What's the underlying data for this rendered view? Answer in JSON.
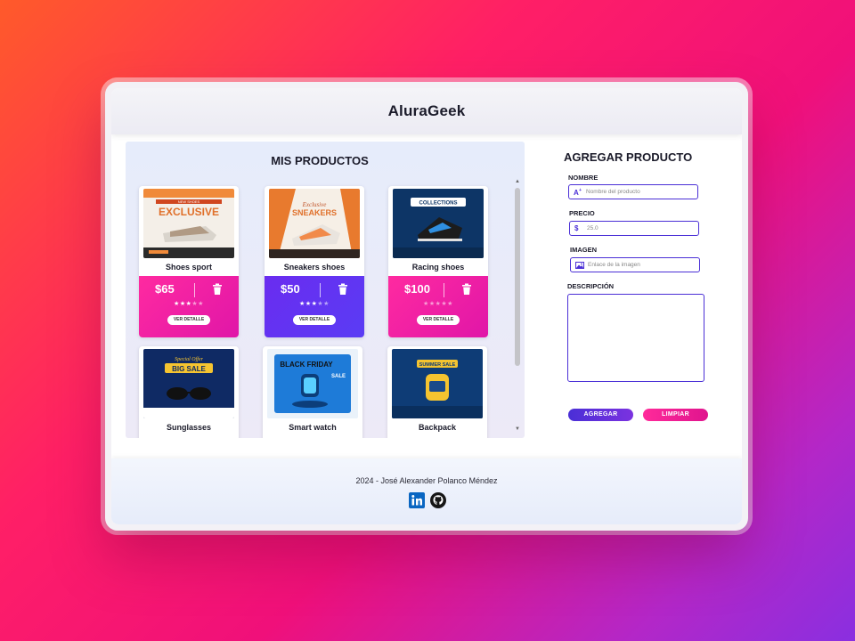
{
  "header": {
    "brand": "AluraGeek"
  },
  "products": {
    "title": "MIS PRODUCTOS",
    "items": [
      {
        "name": "Shoes sport",
        "price": "$65",
        "rating": 3,
        "detail_label": "VER DETALLE",
        "theme": "pink",
        "image": "shoes-sport-ad-image"
      },
      {
        "name": "Sneakers shoes",
        "price": "$50",
        "rating": 3,
        "detail_label": "VER DETALLE",
        "theme": "purple",
        "image": "sneakers-ad-image"
      },
      {
        "name": "Racing shoes",
        "price": "$100",
        "rating": 0,
        "detail_label": "VER DETALLE",
        "theme": "pink",
        "image": "racing-shoes-ad-image"
      },
      {
        "name": "Sunglasses",
        "image": "sunglasses-ad-image"
      },
      {
        "name": "Smart watch",
        "image": "smart-watch-ad-image"
      },
      {
        "name": "Backpack",
        "image": "backpack-ad-image"
      }
    ],
    "image_text": {
      "exclusive": "EXCLUSIVE",
      "new_shoes": "NEW SHOES",
      "sneakers": "SNEAKERS",
      "collections": "COLLECTIONS",
      "big_sale": "BIG SALE",
      "special_offer": "Special Offer",
      "black_friday": "BLACK FRIDAY",
      "sale": "SALE",
      "summer_sale": "SUMMER SALE"
    }
  },
  "form": {
    "title": "AGREGAR PRODUCTO",
    "name": {
      "label": "NOMBRE",
      "placeholder": "Nombre del producto",
      "icon": "text-add-icon"
    },
    "price": {
      "label": "PRECIO",
      "placeholder": "25.0",
      "icon": "dollar-icon",
      "icon_glyph": "$"
    },
    "image": {
      "label": "IMAGEN",
      "placeholder": "Enlace de la imagen",
      "icon": "image-icon"
    },
    "description": {
      "label": "DESCRIPCIÓN"
    },
    "add_button": "AGREGAR",
    "clear_button": "LIMPIAR"
  },
  "footer": {
    "credit": "2024 - José Alexander Polanco Méndez",
    "social": [
      "linkedin-icon",
      "github-icon"
    ]
  },
  "colors": {
    "accent_purple": "#4a2fd6",
    "accent_pink": "#ff2aa0",
    "background_gradient": [
      "#ff5a2a",
      "#ff1f66",
      "#8a2fe0"
    ]
  }
}
